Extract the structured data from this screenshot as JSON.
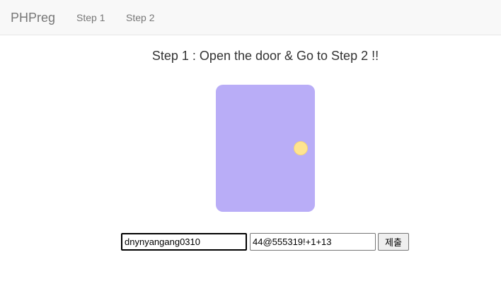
{
  "navbar": {
    "brand": "PHPreg",
    "links": [
      {
        "label": "Step 1"
      },
      {
        "label": "Step 2"
      }
    ]
  },
  "main": {
    "heading": "Step 1 : Open the door & Go to Step 2 !!",
    "door": {
      "door_color": "#b9adf7",
      "knob_color": "#ffe48f"
    },
    "form": {
      "id_value": "dnynyangang0310",
      "pw_value": "44@555319!+1+13",
      "submit_label": "제출"
    }
  }
}
